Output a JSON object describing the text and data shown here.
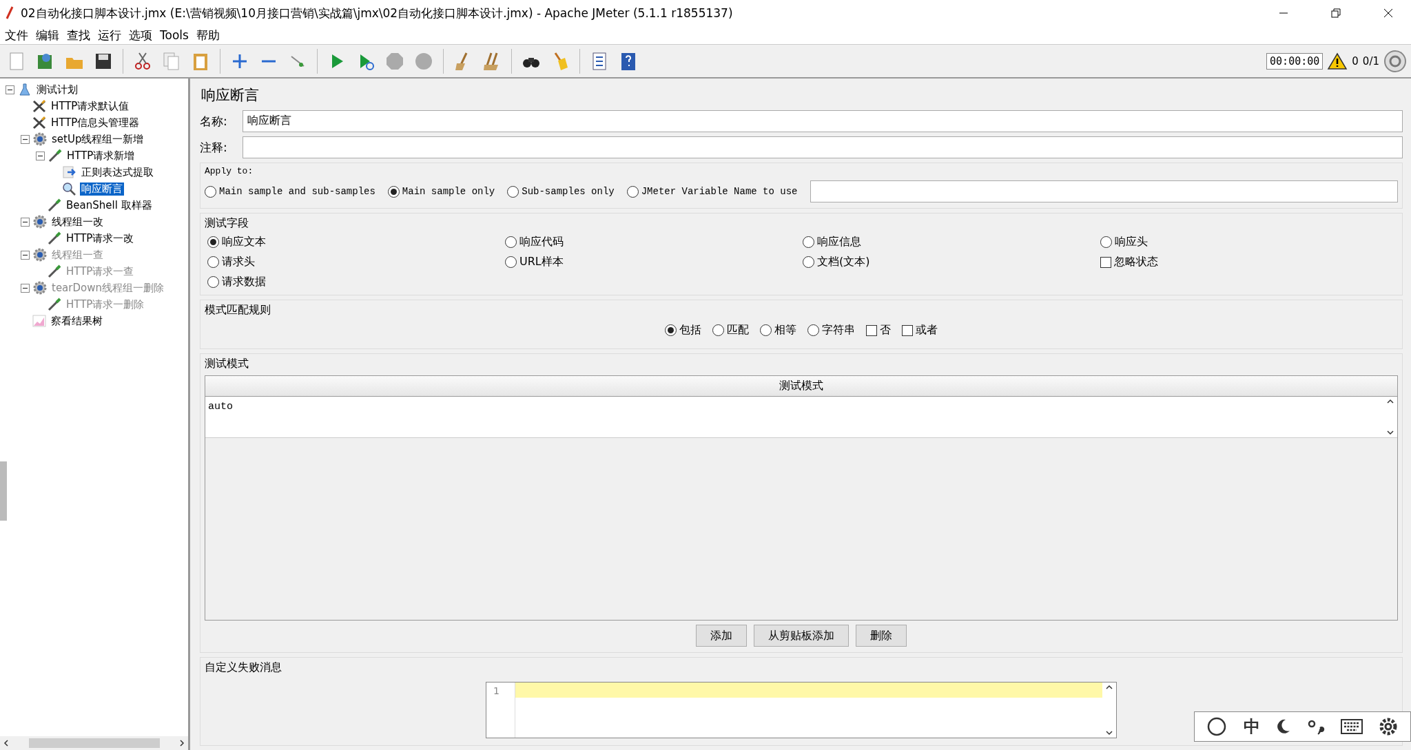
{
  "window": {
    "title": "02自动化接口脚本设计.jmx (E:\\营销视频\\10月接口营销\\实战篇\\jmx\\02自动化接口脚本设计.jmx) - Apache JMeter (5.1.1 r1855137)"
  },
  "menu": [
    "文件",
    "编辑",
    "查找",
    "运行",
    "选项",
    "Tools",
    "帮助"
  ],
  "status": {
    "timer": "00:00:00",
    "warnings": "0",
    "threads": "0/1"
  },
  "tree": [
    {
      "label": "测试计划",
      "kind": "plan",
      "expanded": true,
      "selected": false,
      "disabled": false,
      "children": [
        {
          "label": "HTTP请求默认值",
          "kind": "config",
          "selected": false,
          "disabled": false
        },
        {
          "label": "HTTP信息头管理器",
          "kind": "config",
          "selected": false,
          "disabled": false
        },
        {
          "label": "setUp线程组一新增",
          "kind": "threadgroup",
          "expanded": true,
          "selected": false,
          "disabled": false,
          "children": [
            {
              "label": "HTTP请求新增",
              "kind": "sampler",
              "expanded": true,
              "selected": false,
              "disabled": false,
              "children": [
                {
                  "label": "正则表达式提取",
                  "kind": "extractor",
                  "selected": false,
                  "disabled": false
                },
                {
                  "label": "响应断言",
                  "kind": "assertion",
                  "selected": true,
                  "disabled": false
                }
              ]
            },
            {
              "label": "BeanShell 取样器",
              "kind": "sampler",
              "selected": false,
              "disabled": false
            }
          ]
        },
        {
          "label": "线程组一改",
          "kind": "threadgroup",
          "expanded": true,
          "selected": false,
          "disabled": false,
          "children": [
            {
              "label": "HTTP请求一改",
              "kind": "sampler",
              "selected": false,
              "disabled": false
            }
          ]
        },
        {
          "label": "线程组一查",
          "kind": "threadgroup",
          "expanded": true,
          "selected": false,
          "disabled": true,
          "children": [
            {
              "label": "HTTP请求一查",
              "kind": "sampler",
              "selected": false,
              "disabled": true
            }
          ]
        },
        {
          "label": "tearDown线程组一删除",
          "kind": "threadgroup",
          "expanded": true,
          "selected": false,
          "disabled": true,
          "children": [
            {
              "label": "HTTP请求一删除",
              "kind": "sampler",
              "selected": false,
              "disabled": true
            }
          ]
        },
        {
          "label": "察看结果树",
          "kind": "listener",
          "selected": false,
          "disabled": false
        }
      ]
    }
  ],
  "panel": {
    "title": "响应断言",
    "name": {
      "label": "名称:",
      "value": "响应断言"
    },
    "comment": {
      "label": "注释:"
    },
    "apply_to": {
      "title": "Apply to:",
      "options": [
        {
          "label": "Main sample and sub-samples",
          "selected": false
        },
        {
          "label": "Main sample only",
          "selected": true
        },
        {
          "label": "Sub-samples only",
          "selected": false
        },
        {
          "label": "JMeter Variable Name to use",
          "selected": false
        }
      ]
    },
    "test_field": {
      "title": "测试字段",
      "options": [
        {
          "label": "响应文本",
          "kind": "radio",
          "checked": true
        },
        {
          "label": "响应代码",
          "kind": "radio",
          "checked": false
        },
        {
          "label": "响应信息",
          "kind": "radio",
          "checked": false
        },
        {
          "label": "响应头",
          "kind": "radio",
          "checked": false
        },
        {
          "label": "请求头",
          "kind": "radio",
          "checked": false
        },
        {
          "label": "URL样本",
          "kind": "radio",
          "checked": false
        },
        {
          "label": "文档(文本)",
          "kind": "radio",
          "checked": false
        },
        {
          "label": "忽略状态",
          "kind": "checkbox",
          "checked": false
        },
        {
          "label": "请求数据",
          "kind": "radio",
          "checked": false
        }
      ]
    },
    "match_rules": {
      "title": "模式匹配规则",
      "options": [
        {
          "label": "包括",
          "kind": "radio",
          "checked": true
        },
        {
          "label": "匹配",
          "kind": "radio",
          "checked": false
        },
        {
          "label": "相等",
          "kind": "radio",
          "checked": false
        },
        {
          "label": "字符串",
          "kind": "radio",
          "checked": false
        },
        {
          "label": "否",
          "kind": "checkbox",
          "checked": false
        },
        {
          "label": "或者",
          "kind": "checkbox",
          "checked": false
        }
      ]
    },
    "patterns": {
      "title": "测试模式",
      "column": "测试模式",
      "rows": [
        "auto"
      ],
      "buttons": [
        "添加",
        "从剪贴板添加",
        "删除"
      ]
    },
    "failure_message": {
      "title": "自定义失败消息",
      "line_number": "1"
    }
  },
  "ime": {
    "mode": "中"
  }
}
